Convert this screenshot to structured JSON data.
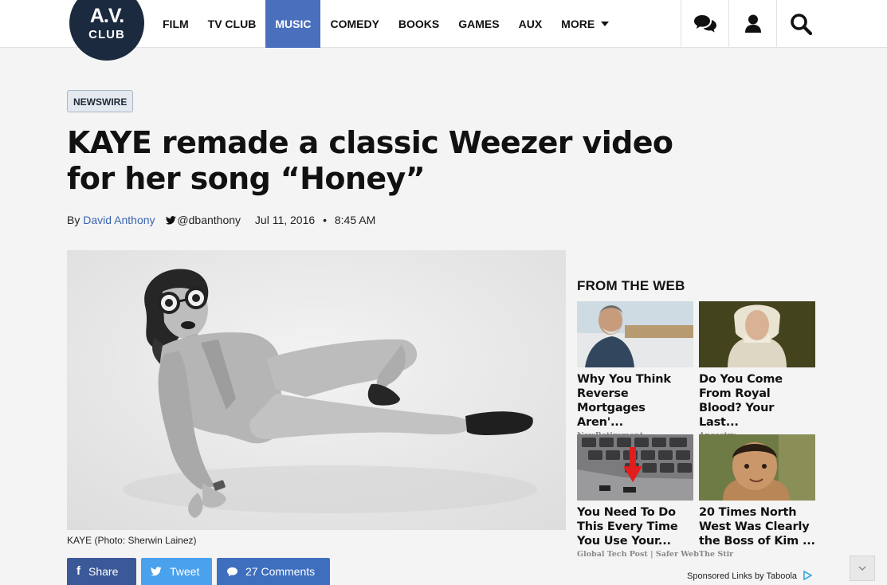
{
  "logo": {
    "line1": "A.V.",
    "line2": "CLUB"
  },
  "nav": {
    "items": [
      {
        "label": "FILM"
      },
      {
        "label": "TV CLUB"
      },
      {
        "label": "MUSIC"
      },
      {
        "label": "COMEDY"
      },
      {
        "label": "BOOKS"
      },
      {
        "label": "GAMES"
      },
      {
        "label": "AUX"
      },
      {
        "label": "MORE"
      }
    ],
    "active": "MUSIC"
  },
  "tools": {
    "icons": [
      "comments-icon",
      "user-icon",
      "search-icon"
    ]
  },
  "article": {
    "tag": "NEWSWIRE",
    "headline": "KAYE remade a classic Weezer video for her song “Honey”",
    "by": "By",
    "author": "David Anthony",
    "twitter": "@dbanthony",
    "date": "Jul 11, 2016",
    "dot": "•",
    "time": "8:45 AM",
    "caption": "KAYE (Photo: Sherwin Lainez)"
  },
  "share": {
    "facebook": {
      "label": "Share",
      "color": "#3b5998"
    },
    "twitter": {
      "label": "Tweet",
      "color": "#4aa1ec"
    },
    "comments": {
      "label": "27 Comments",
      "color": "#3e6fbf"
    }
  },
  "sidebar": {
    "heading": "FROM THE WEB",
    "cards": [
      {
        "title": "Why You Think Reverse Mortgages Aren'...",
        "source": "NewRetirement"
      },
      {
        "title": "Do You Come From Royal Blood? Your Last...",
        "source": "Ancestry"
      },
      {
        "title": "You Need To Do This Every Time You Use Your...",
        "source": "Global Tech Post | Safer Web"
      },
      {
        "title": "20 Times North West Was Clearly the Boss of Kim ...",
        "source": "The Stir"
      }
    ],
    "sponsored": "Sponsored Links by Taboola"
  },
  "colors": {
    "accent": "#4a6fbd",
    "logo": "#1b2a3e",
    "link": "#3a64b1"
  }
}
